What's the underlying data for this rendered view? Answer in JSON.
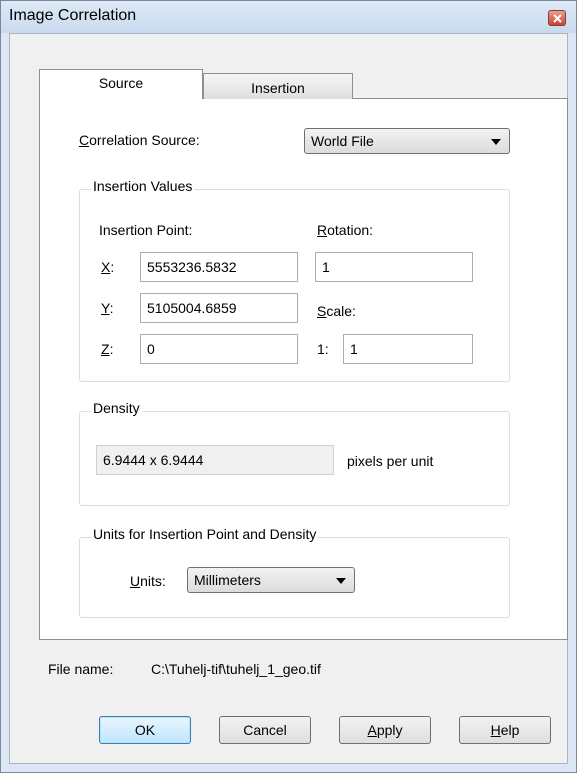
{
  "window": {
    "title": "Image Correlation"
  },
  "tabs": [
    {
      "label": "Source",
      "active": true
    },
    {
      "label": "Insertion",
      "active": false
    }
  ],
  "source": {
    "label_prefix": "",
    "label_key": "C",
    "label_rest": "orrelation Source:",
    "value": "World File"
  },
  "insertion_values": {
    "title": "Insertion Values",
    "point_label": "Insertion Point:",
    "x_key": "X",
    "x_rest": ":",
    "x_value": "5553236.5832",
    "y_key": "Y",
    "y_rest": ":",
    "y_value": "5105004.6859",
    "z_key": "Z",
    "z_rest": ":",
    "z_value": "0",
    "rotation_key": "R",
    "rotation_rest": "otation:",
    "rotation_value": "1",
    "scale_key": "S",
    "scale_rest": "cale:",
    "scale_prefix": "1:",
    "scale_value": "1"
  },
  "density": {
    "title": "Density",
    "value": "6.9444 x 6.9444",
    "unit_label": "pixels per unit"
  },
  "units": {
    "title": "Units for Insertion Point and Density",
    "label_key": "U",
    "label_rest": "nits:",
    "value": "Millimeters"
  },
  "file": {
    "label": "File name:",
    "path": "C:\\Tuhelj-tif\\tuhelj_1_geo.tif"
  },
  "buttons": {
    "ok": "OK",
    "cancel": "Cancel",
    "apply_key": "A",
    "apply_rest": "pply",
    "help_key": "H",
    "help_rest": "elp"
  },
  "colors": {
    "title_bar": "#c9daee",
    "close_button": "#c9452f",
    "dialog_bg": "#f0f0f0"
  },
  "icons": {
    "close": "close-icon",
    "dropdown": "chevron-down-icon"
  }
}
